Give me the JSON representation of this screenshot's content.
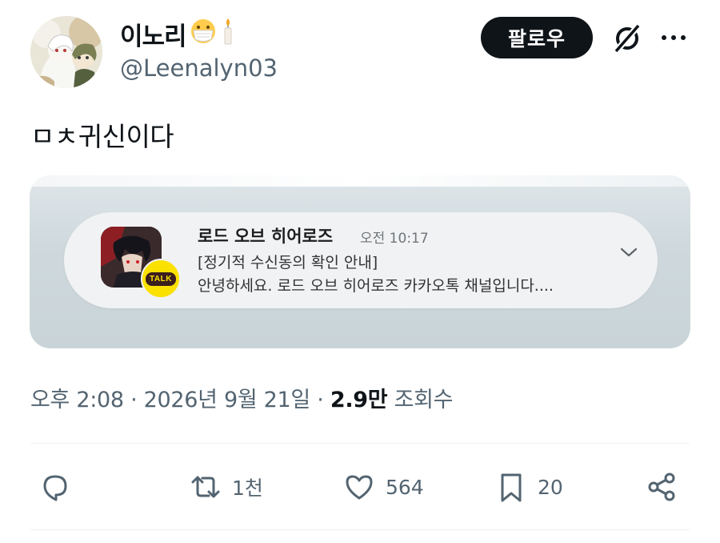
{
  "user": {
    "display_name": "이노리",
    "handle": "@Leenalyn03",
    "emojis": [
      "mask-emoji",
      "candle-emoji"
    ]
  },
  "header": {
    "follow_label": "팔로우"
  },
  "tweet": {
    "text": "ㅁㅊ귀신이다"
  },
  "notification": {
    "app_name": "로드 오브 히어로즈",
    "time": "오전 10:17",
    "line1": "[정기적 수신동의 확인 안내]",
    "line2": "안녕하세요. 로드 오브 히어로즈 카카오톡 채널입니다....",
    "badge": "TALK"
  },
  "meta": {
    "timestamp": "오후 2:08 · 2026년 9월 21일 · ",
    "views_count": "2.9만",
    "views_label": " 조회수"
  },
  "actions": {
    "retweets": "1천",
    "likes": "564",
    "bookmarks": "20"
  },
  "colors": {
    "text": "#0f1419",
    "secondary": "#536471",
    "follow_bg": "#0f1419",
    "kakao_yellow": "#fae100"
  }
}
